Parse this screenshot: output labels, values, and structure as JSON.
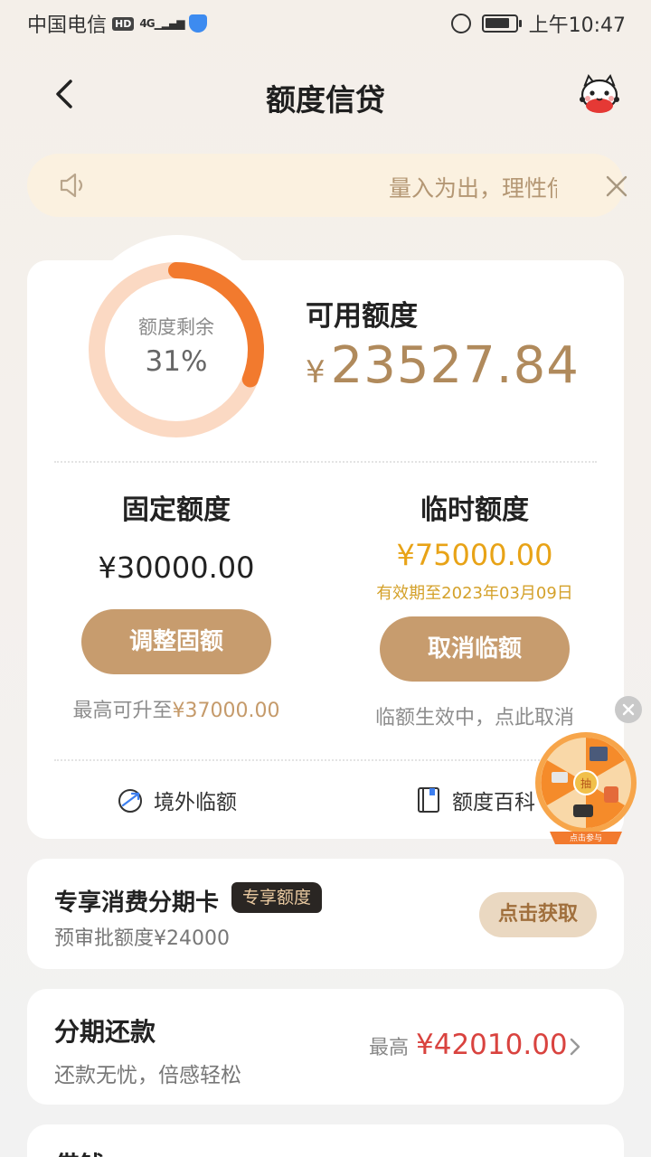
{
  "status_bar": {
    "carrier": "中国电信",
    "hd_badge": "HD",
    "network": "4G",
    "time": "上午10:47"
  },
  "header": {
    "title": "额度信贷",
    "back_icon": "chevron-left-icon",
    "mascot_icon": "cat-mascot-icon"
  },
  "notice": {
    "text": "量入为出，理性借贷",
    "speaker_icon": "speaker-icon",
    "close_icon": "close-icon"
  },
  "quota_summary": {
    "ring_label": "额度剩余",
    "remaining_percent_text": "31%",
    "remaining_fraction": 0.31,
    "available_label": "可用额度",
    "currency": "¥",
    "available_amount": "23527.84"
  },
  "fixed_quota": {
    "title": "固定额度",
    "amount": "¥30000.00",
    "button": "调整固额",
    "note_prefix": "最高可升至",
    "note_amount": "¥37000.00"
  },
  "temp_quota": {
    "title": "临时额度",
    "amount": "¥75000.00",
    "validity": "有效期至2023年03月09日",
    "button": "取消临额",
    "note": "临额生效中，点此取消"
  },
  "links": {
    "overseas": "境外临额",
    "encyclopedia": "额度百科"
  },
  "installment_card": {
    "title": "专享消费分期卡",
    "badge": "专享额度",
    "subtitle": "预审批额度¥24000",
    "button": "点击获取"
  },
  "repayment": {
    "title": "分期还款",
    "subtitle": "还款无忧，倍感轻松",
    "prefix": "最高",
    "amount": "¥42010.00"
  },
  "borrow": {
    "title": "借钱"
  },
  "promo_wheel": {
    "center_label": "抽",
    "caption": "点击参与"
  },
  "colors": {
    "accent_gold": "#c79c6e",
    "ring_orange": "#f27a2e",
    "temp_gold": "#e8a317",
    "amount_red": "#d9433f"
  }
}
